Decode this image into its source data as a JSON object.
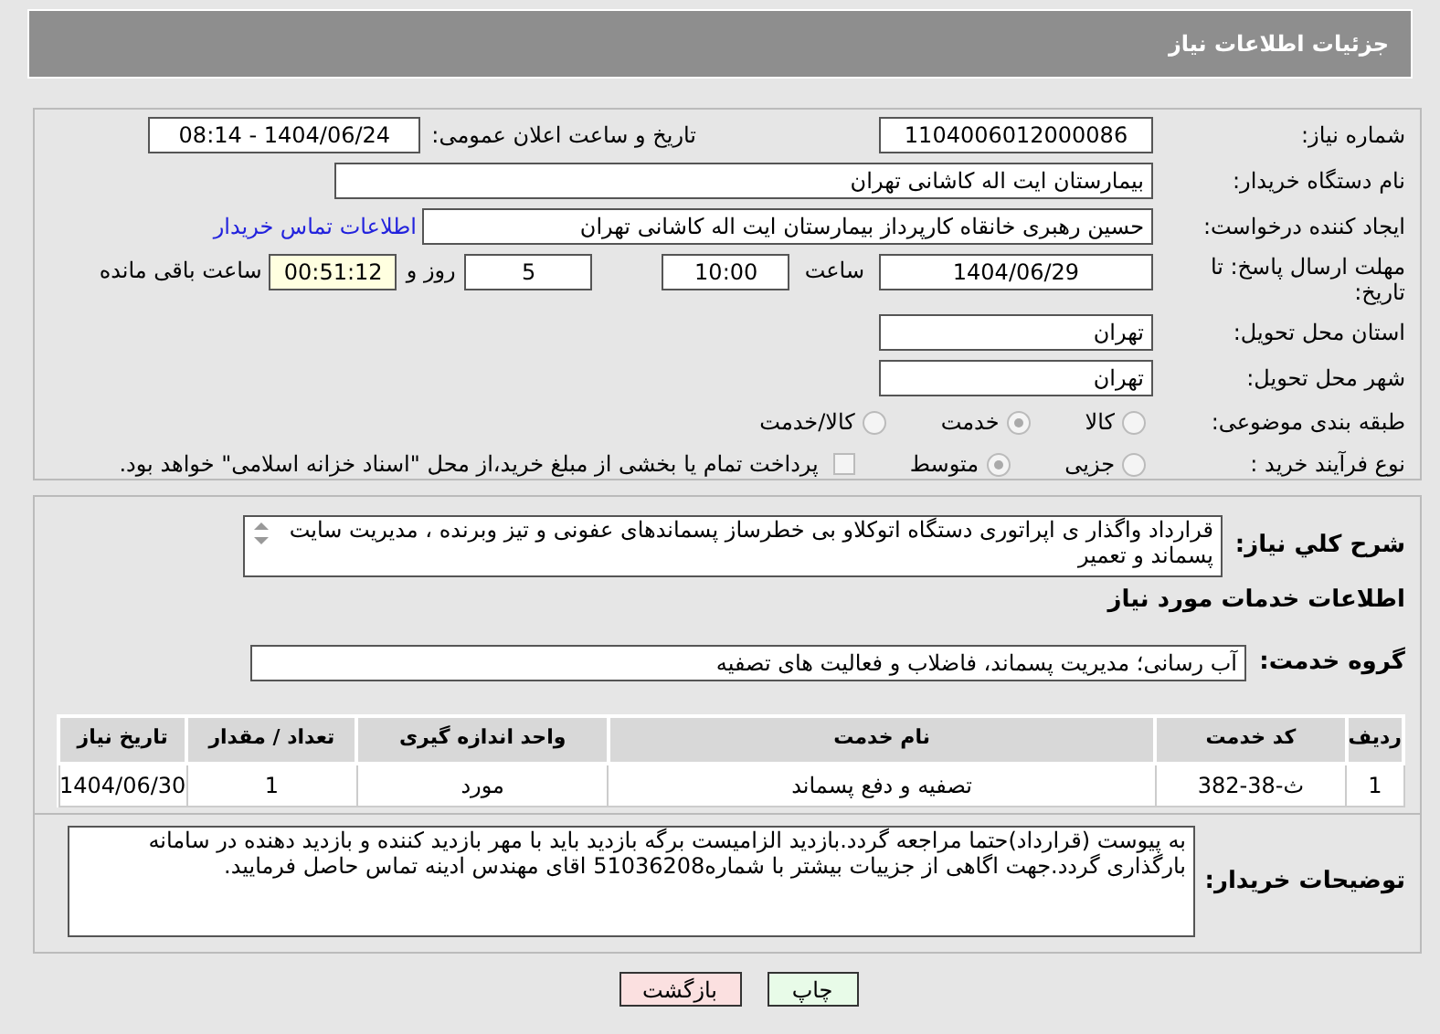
{
  "header": {
    "title": "جزئیات اطلاعات نیاز"
  },
  "need_number": {
    "label": "شماره نیاز:",
    "value": "1104006012000086"
  },
  "announce": {
    "label": "تاریخ و ساعت اعلان عمومی:",
    "value": "1404/06/24 - 08:14"
  },
  "buyer": {
    "label": "نام دستگاه خریدار:",
    "value": "بیمارستان ایت اله کاشانی تهران"
  },
  "creator": {
    "label": "ایجاد کننده درخواست:",
    "value": "حسین رهبری خانقاه کارپرداز بیمارستان ایت اله کاشانی تهران",
    "link": "اطلاعات تماس خریدار"
  },
  "deadline": {
    "label": "مهلت ارسال پاسخ: تا تاریخ:",
    "date": "1404/06/29",
    "time_label": "ساعت",
    "time": "10:00",
    "days": "5",
    "days_label": "روز و",
    "remaining": "00:51:12",
    "remaining_label": "ساعت باقی مانده"
  },
  "province": {
    "label": "استان محل تحویل:",
    "value": "تهران"
  },
  "city": {
    "label": "شهر محل تحویل:",
    "value": "تهران"
  },
  "category": {
    "label": "طبقه بندی موضوعی:",
    "options": [
      {
        "label": "کالا",
        "selected": false
      },
      {
        "label": "خدمت",
        "selected": true
      },
      {
        "label": "کالا/خدمت",
        "selected": false
      }
    ]
  },
  "process": {
    "label": "نوع فرآیند خرید :",
    "options": [
      {
        "label": "جزیی",
        "selected": false
      },
      {
        "label": "متوسط",
        "selected": true
      }
    ],
    "payment": {
      "label": "پرداخت تمام یا بخشی از مبلغ خرید،از محل \"اسناد خزانه اسلامی\" خواهد بود.",
      "checked": false
    }
  },
  "description": {
    "label": "شرح کلي نياز:",
    "value": "قرارداد واگذار ی اپراتوری دستگاه اتوکلاو بی خطرساز پسماندهای عفونی و تیز وبرنده ، مدیریت سایت پسماند و تعمیر"
  },
  "services_heading": "اطلاعات خدمات مورد نیاز",
  "service_group": {
    "label": "گروه خدمت:",
    "value": "آب رسانی؛ مدیریت پسماند، فاضلاب و فعالیت های تصفیه"
  },
  "table": {
    "columns": [
      "ردیف",
      "کد خدمت",
      "نام خدمت",
      "واحد اندازه گیری",
      "تعداد / مقدار",
      "تاریخ نیاز"
    ],
    "rows": [
      [
        "1",
        "ث-38-382",
        "تصفیه و دفع پسماند",
        "مورد",
        "1",
        "1404/06/30"
      ]
    ]
  },
  "notes": {
    "label": "توضیحات خریدار:",
    "value": "به پیوست (قرارداد)حتما مراجعه گردد.بازدید الزامیست برگه بازدید باید با مهر بازدید کننده و بازدید دهنده در سامانه بارگذاری گردد.جهت اگاهی از جزییات بیشتر با شماره51036208 اقای مهندس ادینه تماس حاصل فرمایید."
  },
  "buttons": [
    {
      "label": "چاپ",
      "kind": "print"
    },
    {
      "label": "بازگشت",
      "kind": "back"
    }
  ]
}
